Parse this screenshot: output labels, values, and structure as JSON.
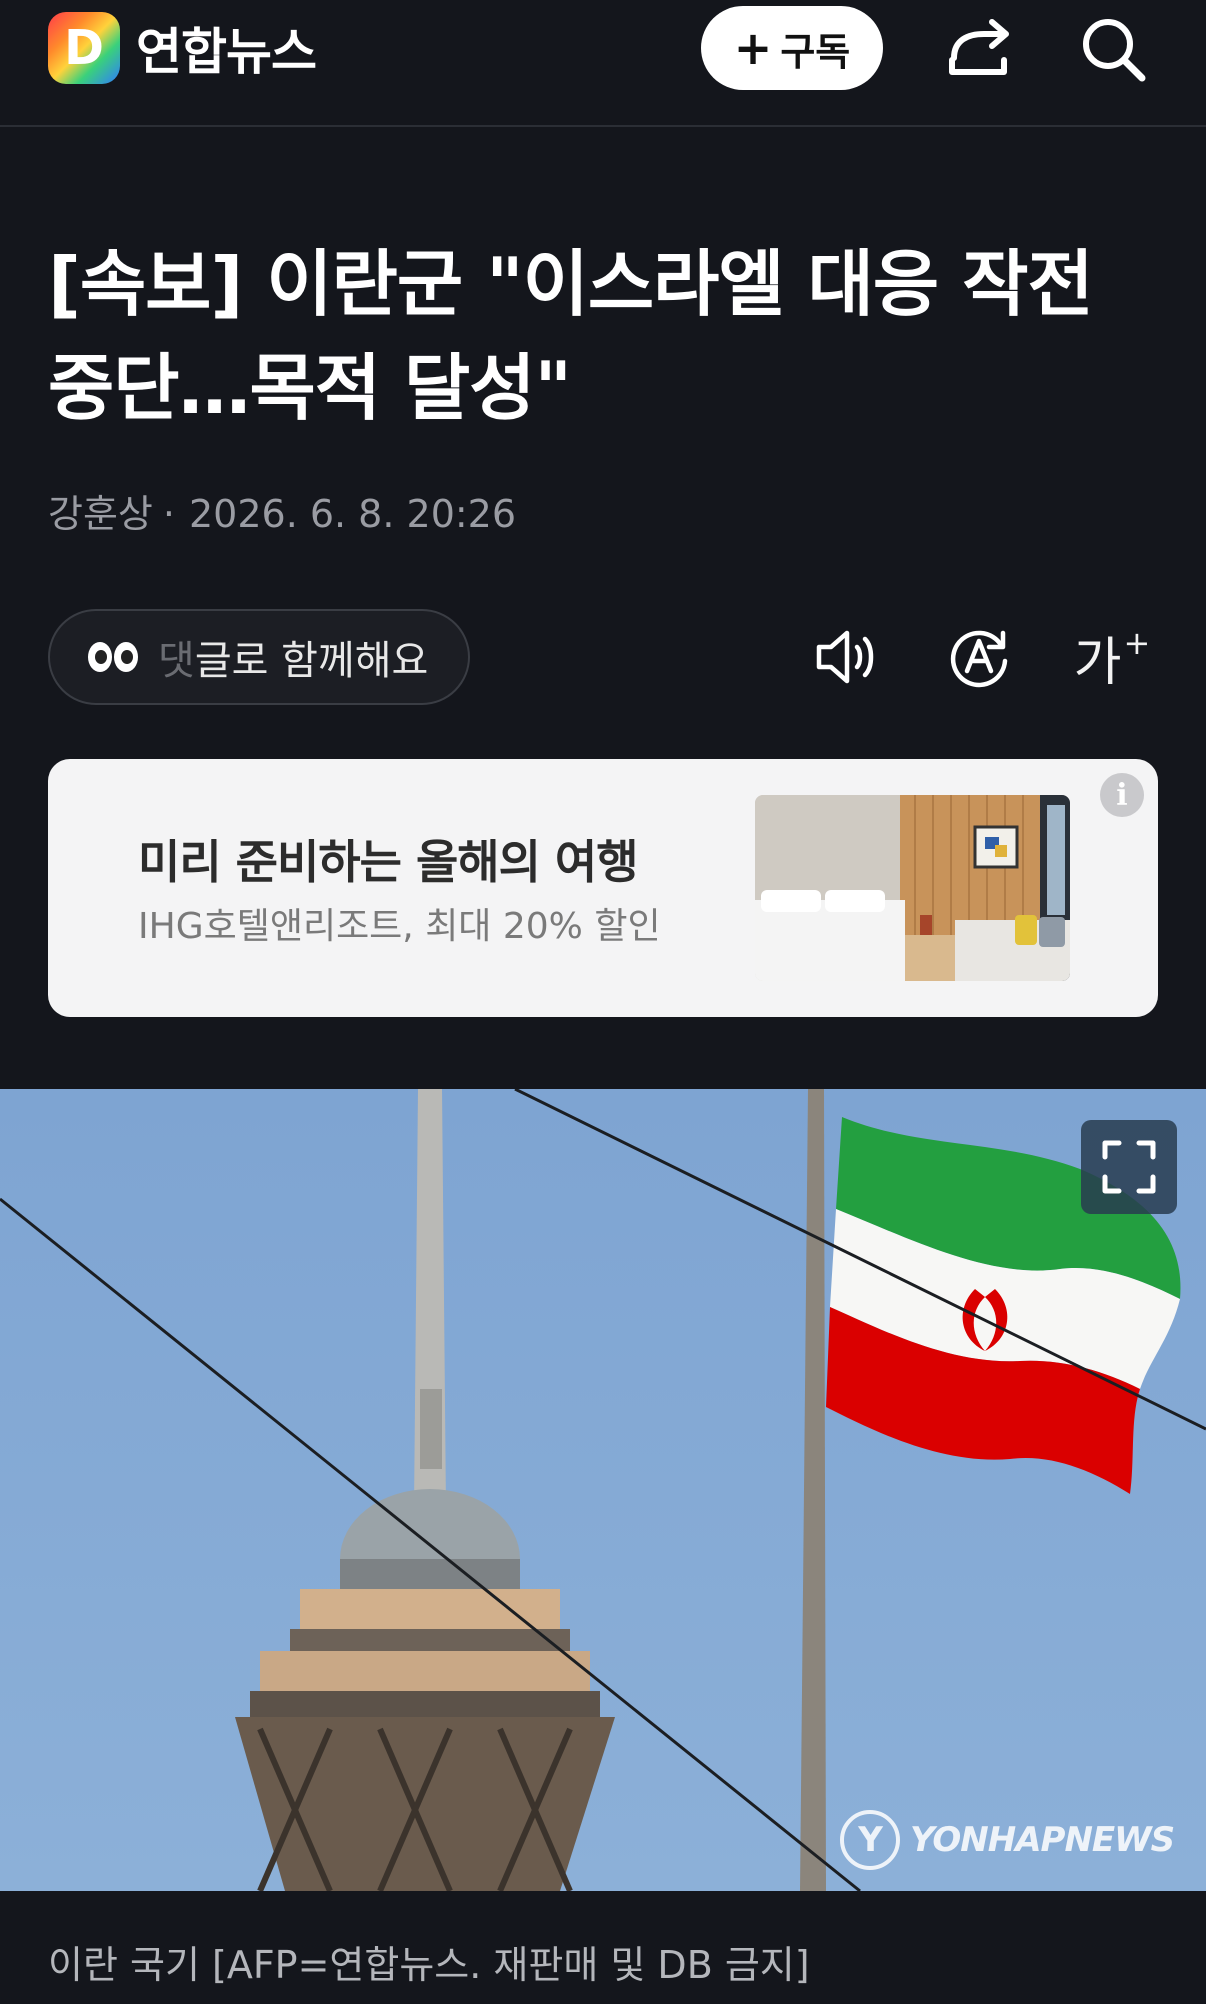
{
  "header": {
    "brand_letter": "D",
    "brand_name": "연합뉴스",
    "subscribe_label": "구독",
    "subscribe_plus": "+"
  },
  "article": {
    "headline": "[속보] 이란군 \"이스라엘 대응 작전 중단…목적 달성\"",
    "author": "강훈상",
    "separator": "·",
    "timestamp": "2026. 6. 8. 20:26"
  },
  "tools": {
    "comment_faded": "댓",
    "comment_text": "글로 함께해요",
    "font_size_label": "가",
    "font_size_plus": "+"
  },
  "ad": {
    "title": "미리 준비하는 올해의 여행",
    "subtitle": "IHG호텔앤리조트, 최대 20% 할인",
    "info_glyph": "i"
  },
  "photo": {
    "watermark_text": "YONHAPNEWS",
    "watermark_logo": "Y"
  },
  "caption": "이란 국기 [AFP=연합뉴스. 재판매 및 DB 금지]",
  "colors": {
    "background": "#14161c",
    "flag_green": "#239f40",
    "flag_red": "#da0000",
    "sky": "#7fa3cf"
  },
  "icons": [
    "share-icon",
    "search-icon",
    "speaker-icon",
    "translate-icon",
    "info-icon",
    "expand-icon"
  ]
}
